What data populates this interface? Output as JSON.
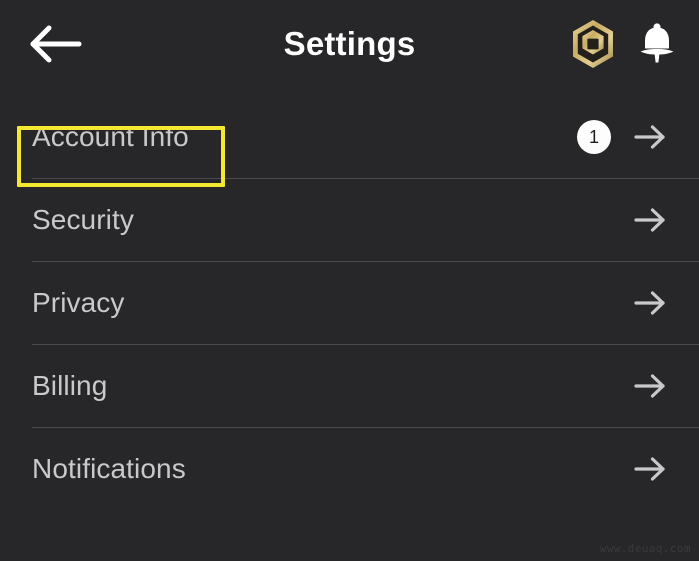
{
  "header": {
    "back_icon": "arrow-left-icon",
    "title": "Settings",
    "robux_icon": "robux-currency-icon",
    "bell_icon": "notification-bell-icon"
  },
  "list": {
    "rows": [
      {
        "label": "Account Info",
        "badge": "1",
        "chevron": "arrow-right-icon",
        "highlighted": true
      },
      {
        "label": "Security",
        "badge": "",
        "chevron": "arrow-right-icon",
        "highlighted": false
      },
      {
        "label": "Privacy",
        "badge": "",
        "chevron": "arrow-right-icon",
        "highlighted": false
      },
      {
        "label": "Billing",
        "badge": "",
        "chevron": "arrow-right-icon",
        "highlighted": false
      },
      {
        "label": "Notifications",
        "badge": "",
        "chevron": "arrow-right-icon",
        "highlighted": false
      }
    ]
  },
  "watermark": "www.deuaq.com",
  "colors": {
    "background": "#272729",
    "text_primary": "#ffffff",
    "text_secondary": "#c9c9cb",
    "divider": "#4a4a4d",
    "highlight": "#f3e82f",
    "badge_bg": "#fdfdfd",
    "robux_gold": "#d4b873"
  }
}
